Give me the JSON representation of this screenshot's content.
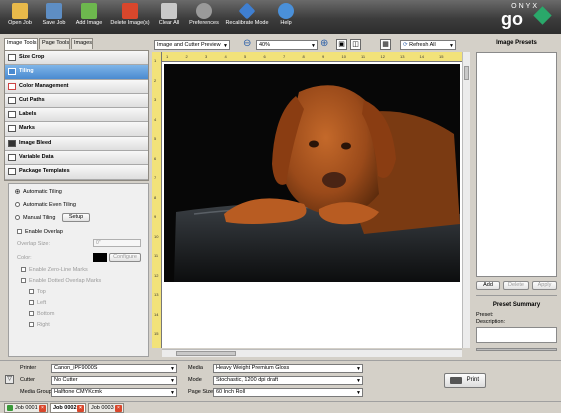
{
  "toolbar": {
    "buttons": [
      {
        "label": "Open Job",
        "icon": "folder-icon",
        "color": "#e8b94a"
      },
      {
        "label": "Save Job",
        "icon": "save-icon",
        "color": "#5e8ec4"
      },
      {
        "label": "Add Image",
        "icon": "add-image-icon",
        "color": "#6db84e"
      },
      {
        "label": "Delete Image(s)",
        "icon": "delete-image-icon",
        "color": "#d9472c"
      },
      {
        "label": "Clear All",
        "icon": "trash-icon",
        "color": "#c9c9c9"
      },
      {
        "label": "Preferences",
        "icon": "gear-icon",
        "color": "#9a9a9a"
      },
      {
        "label": "Recalibrate Mode",
        "icon": "recalibrate-icon",
        "color": "#3f7fd1"
      },
      {
        "label": "Help",
        "icon": "help-icon",
        "color": "#4a90d9"
      }
    ],
    "logo_top": "ONYX",
    "logo_main": "go"
  },
  "left_panel": {
    "tabs": [
      "Image Tools",
      "Page Tools",
      "Images"
    ],
    "sections": [
      {
        "label": "Size Crop",
        "icon": "size-crop-icon"
      },
      {
        "label": "Tiling",
        "icon": "tiling-icon",
        "active": true
      },
      {
        "label": "Color Management",
        "icon": "color-management-icon"
      },
      {
        "label": "Cut Paths",
        "icon": "cut-paths-icon"
      },
      {
        "label": "Labels",
        "icon": "labels-icon"
      },
      {
        "label": "Marks",
        "icon": "marks-icon"
      },
      {
        "label": "Image Bleed",
        "icon": "image-bleed-icon"
      },
      {
        "label": "Variable Data",
        "icon": "variable-data-icon"
      },
      {
        "label": "Package Templates",
        "icon": "package-templates-icon"
      }
    ],
    "tiling": {
      "automatic": "Automatic Tiling",
      "automatic_even": "Automatic Even Tiling",
      "manual": "Manual Tiling",
      "setup": "Setup",
      "enable_overlap": "Enable Overlap",
      "overlap_size_label": "Overlap Size:",
      "overlap_size_value": "0\"",
      "color_label": "Color:",
      "configure": "Configure",
      "zero_line": "Enable Zero-Line Marks",
      "dotted_overlap": "Enable Dotted Overlap Marks",
      "top": "Top",
      "left": "Left",
      "bottom": "Bottom",
      "right": "Right"
    }
  },
  "preview": {
    "mode": "Image and Cutter Preview",
    "zoom": "40%",
    "refresh": "Refresh All",
    "ruler_ticks": [
      "1",
      "2",
      "3",
      "4",
      "5",
      "6",
      "7",
      "8",
      "9",
      "10",
      "11",
      "12",
      "13",
      "14",
      "15"
    ]
  },
  "right_panel": {
    "presets_title": "Image Presets",
    "add": "Add",
    "delete": "Delete",
    "apply": "Apply",
    "summary_title": "Preset Summary",
    "preset_label": "Preset:",
    "description_label": "Description:"
  },
  "bottom": {
    "printer_label": "Printer",
    "printer_value": "Canon_iPF9000S",
    "cutter_label": "Cutter",
    "cutter_value": "No Cutter",
    "media_group_label": "Media Group",
    "media_group_value": "Halftone CMYKcmk",
    "media_label": "Media",
    "media_value": "Heavy Weight Premium Gloss",
    "mode_label": "Mode",
    "mode_value": "Stochastic, 1200 dpi draft",
    "page_size_label": "Page Size",
    "page_size_value": "60 Inch Roll",
    "print": "Print"
  },
  "jobs": [
    {
      "label": "Job 0001",
      "active": false
    },
    {
      "label": "Job 0002",
      "active": true
    },
    {
      "label": "Job 0003",
      "active": false
    }
  ],
  "colors": {
    "active_section": "#4a8ad0",
    "ruler": "#f2e27a",
    "toolbar_dark": "#3c3c3c",
    "logo_gem": "#2aa86a"
  }
}
